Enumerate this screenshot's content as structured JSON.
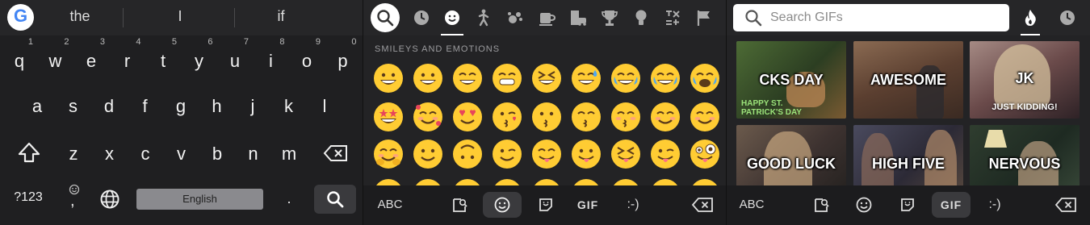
{
  "keyboard": {
    "suggestions": [
      "the",
      "I",
      "if"
    ],
    "row1": [
      {
        "key": "q",
        "hint": "1"
      },
      {
        "key": "w",
        "hint": "2"
      },
      {
        "key": "e",
        "hint": "3"
      },
      {
        "key": "r",
        "hint": "4"
      },
      {
        "key": "t",
        "hint": "5"
      },
      {
        "key": "y",
        "hint": "6"
      },
      {
        "key": "u",
        "hint": "7"
      },
      {
        "key": "i",
        "hint": "8"
      },
      {
        "key": "o",
        "hint": "9"
      },
      {
        "key": "p",
        "hint": "0"
      }
    ],
    "row2": [
      "a",
      "s",
      "d",
      "f",
      "g",
      "h",
      "j",
      "k",
      "l"
    ],
    "row3": [
      "z",
      "x",
      "c",
      "v",
      "b",
      "n",
      "m"
    ],
    "symbols_label": "?123",
    "comma": ",",
    "period": ".",
    "space_label": "English"
  },
  "emoji_panel": {
    "section_label": "SMILEYS AND EMOTIONS",
    "categories": [
      "recent-icon",
      "smiley-icon",
      "person-icon",
      "animal-icon",
      "food-icon",
      "travel-icon",
      "trophy-icon",
      "object-icon",
      "symbol-icon",
      "flag-icon"
    ],
    "selected_category": "smiley-icon",
    "abc_label": "ABC",
    "gif_label": "GIF",
    "emoticon_label": ":-)"
  },
  "gif_panel": {
    "search_placeholder": "Search GIFs",
    "abc_label": "ABC",
    "gif_label": "GIF",
    "emoticon_label": ":-)",
    "tiles": [
      {
        "label": "CKS DAY",
        "sub": "HAPPY ST. PATRICK'S DAY",
        "bg": "#3e5a2c"
      },
      {
        "label": "AWESOME",
        "sub": "",
        "bg": "#6b4a3a"
      },
      {
        "label": "JK",
        "sub": "JUST KIDDING!",
        "bg": "#7a5a5a"
      },
      {
        "label": "GOOD LUCK",
        "sub": "",
        "bg": "#5a4a3e"
      },
      {
        "label": "HIGH FIVE",
        "sub": "",
        "bg": "#3d3a4a"
      },
      {
        "label": "NERVOUS",
        "sub": "",
        "bg": "#2e3a2e"
      }
    ]
  },
  "colors": {
    "background": "#1d1d1f",
    "emoji_yellow": "#ffcc33",
    "accent_white": "#ffffff"
  }
}
